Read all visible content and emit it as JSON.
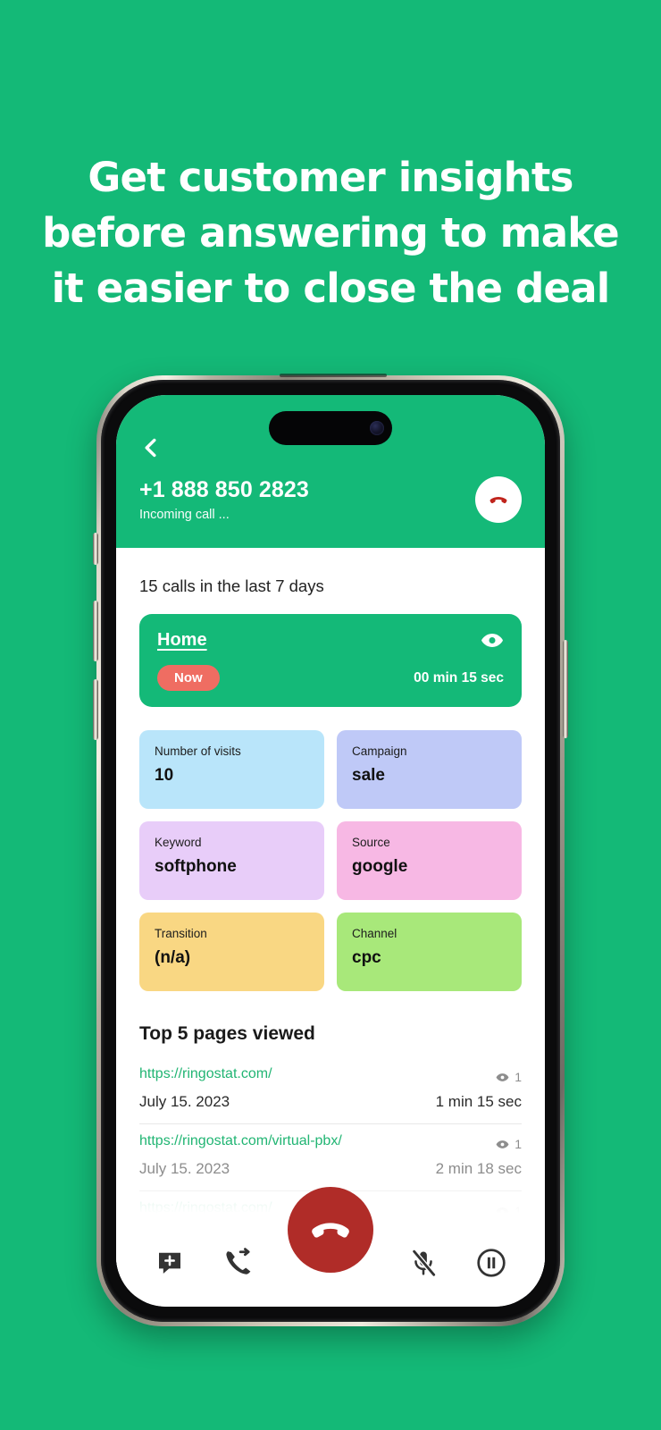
{
  "headline": {
    "lines": [
      "Get customer insights",
      "before answering to make",
      "it easier to close the deal"
    ]
  },
  "colors": {
    "brand_green": "#14b978",
    "accent_red": "#b02c28",
    "badge_red": "#ef6d62",
    "link_green": "#21b573"
  },
  "call_screen": {
    "header": {
      "back_icon": "chevron-left-icon",
      "phone_number": "+1 888 850 2823",
      "status": "Incoming call ...",
      "hangup_icon": "phone-hangup-icon"
    },
    "calls_summary": "15 calls in the last 7 days",
    "active_page": {
      "title": "Home",
      "eye_icon": "eye-icon",
      "badge": "Now",
      "duration": "00 min 15 sec"
    },
    "tiles": [
      {
        "label": "Number of visits",
        "value": "10",
        "color": "#b9e5fa"
      },
      {
        "label": "Campaign",
        "value": "sale",
        "color": "#bfc9f7"
      },
      {
        "label": "Keyword",
        "value": "softphone",
        "color": "#e8cdf9"
      },
      {
        "label": "Source",
        "value": "google",
        "color": "#f7b8e4"
      },
      {
        "label": "Transition",
        "value": "(n/a)",
        "color": "#f9d783"
      },
      {
        "label": "Channel",
        "value": "cpc",
        "color": "#a8e87a"
      }
    ],
    "pages_section": {
      "title": "Top 5 pages viewed",
      "rows": [
        {
          "url": "https://ringostat.com/",
          "date": "July 15. 2023",
          "views": "1",
          "duration": "1 min 15 sec",
          "dim": false
        },
        {
          "url": "https://ringostat.com/virtual-pbx/",
          "date": "July 15. 2023",
          "views": "1",
          "duration": "2 min 18 sec",
          "dim": true
        },
        {
          "url": "https://ringostat.com/",
          "date": "",
          "views": "1",
          "duration": "",
          "dim": true
        }
      ]
    },
    "toolbar": {
      "add_note_icon": "message-plus-icon",
      "transfer_icon": "call-transfer-icon",
      "hangup_icon": "phone-hangup-icon",
      "mute_icon": "microphone-off-icon",
      "hold_icon": "pause-circle-icon"
    }
  }
}
